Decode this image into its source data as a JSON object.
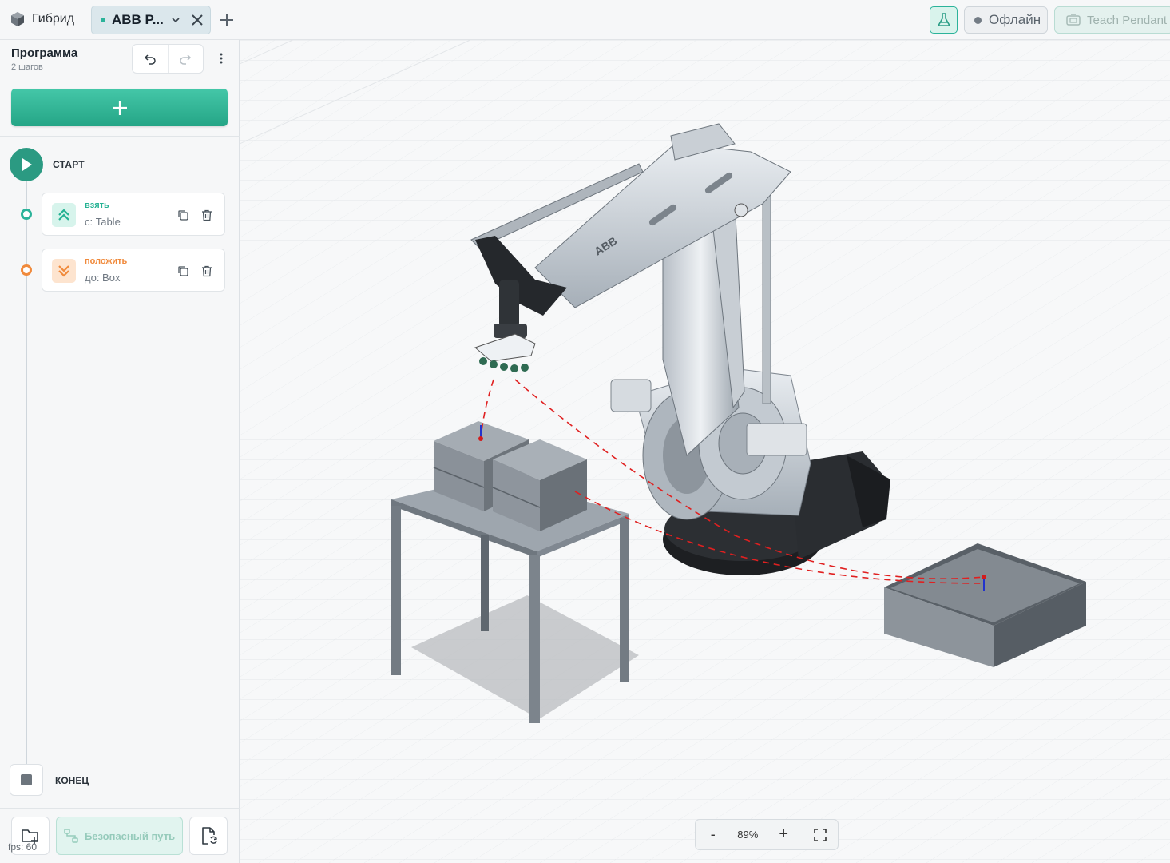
{
  "app": {
    "brand": "Гибрид",
    "tab_label": "ABB P...",
    "offline_label": "Офлайн",
    "pendant_label": "Teach Pendant"
  },
  "program": {
    "title": "Программа",
    "subtitle": "2 шагов",
    "start_label": "СТАРТ",
    "end_label": "КОНЕЦ",
    "steps": [
      {
        "name": "взять",
        "target": "с: Table",
        "kind": "pick",
        "color": "#25b293"
      },
      {
        "name": "положить",
        "target": "до: Box",
        "kind": "place",
        "color": "#f08a3c"
      }
    ]
  },
  "footer": {
    "safe_path_label": "Безопасный путь",
    "fps": "fps: 60"
  },
  "viewport": {
    "zoom": "89%",
    "zoom_minus": "-",
    "zoom_plus": "+",
    "robot_logo": "ABB"
  },
  "colors": {
    "accent": "#2bb39a",
    "place": "#f08a3c",
    "path": "#e02020"
  }
}
